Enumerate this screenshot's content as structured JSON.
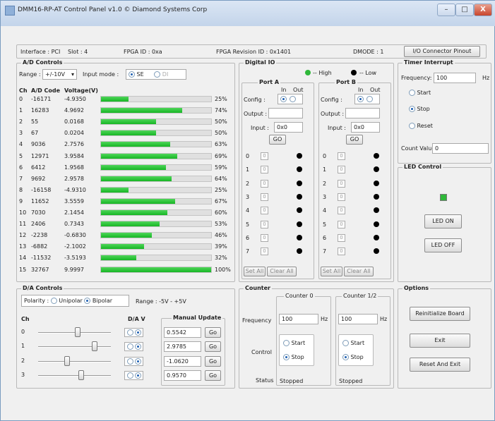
{
  "window": {
    "title": "DMM16-RP-AT Control Panel v1.0 © Diamond Systems Corp",
    "min": "–",
    "max": "□",
    "close": "X"
  },
  "info": {
    "interface": "Interface : PCI",
    "slot": "Slot : 4",
    "fpga_id": "FPGA ID : 0xa",
    "fpga_rev": "FPGA Revision ID : 0x1401",
    "dmode": "DMODE : 1",
    "pinout_btn": "I/O Connector Pinout"
  },
  "ad": {
    "title": "A/D Controls",
    "range_label": "Range :",
    "range_value": "+/-10V",
    "input_mode_label": "Input mode :",
    "mode_se": "SE",
    "mode_di": "DI",
    "headers": [
      "Ch",
      "A/D Code",
      "Voltage(V)"
    ],
    "rows": [
      {
        "ch": "0",
        "code": "-16171",
        "volt": "-4.9350",
        "pct": "25%",
        "val": 25
      },
      {
        "ch": "1",
        "code": "16283",
        "volt": "4.9692",
        "pct": "74%",
        "val": 74
      },
      {
        "ch": "2",
        "code": "55",
        "volt": "0.0168",
        "pct": "50%",
        "val": 50
      },
      {
        "ch": "3",
        "code": "67",
        "volt": "0.0204",
        "pct": "50%",
        "val": 50
      },
      {
        "ch": "4",
        "code": "9036",
        "volt": "2.7576",
        "pct": "63%",
        "val": 63
      },
      {
        "ch": "5",
        "code": "12971",
        "volt": "3.9584",
        "pct": "69%",
        "val": 69
      },
      {
        "ch": "6",
        "code": "6412",
        "volt": "1.9568",
        "pct": "59%",
        "val": 59
      },
      {
        "ch": "7",
        "code": "9692",
        "volt": "2.9578",
        "pct": "64%",
        "val": 64
      },
      {
        "ch": "8",
        "code": "-16158",
        "volt": "-4.9310",
        "pct": "25%",
        "val": 25
      },
      {
        "ch": "9",
        "code": "11652",
        "volt": "3.5559",
        "pct": "67%",
        "val": 67
      },
      {
        "ch": "10",
        "code": "7030",
        "volt": "2.1454",
        "pct": "60%",
        "val": 60
      },
      {
        "ch": "11",
        "code": "2406",
        "volt": "0.7343",
        "pct": "53%",
        "val": 53
      },
      {
        "ch": "12",
        "code": "-2238",
        "volt": "-0.6830",
        "pct": "46%",
        "val": 46
      },
      {
        "ch": "13",
        "code": "-6882",
        "volt": "-2.1002",
        "pct": "39%",
        "val": 39
      },
      {
        "ch": "14",
        "code": "-11532",
        "volt": "-3.5193",
        "pct": "32%",
        "val": 32
      },
      {
        "ch": "15",
        "code": "32767",
        "volt": "9.9997",
        "pct": "100%",
        "val": 100
      }
    ]
  },
  "dio": {
    "title": "Digital IO",
    "high": "-- High",
    "low": "-- Low",
    "portA": {
      "title": "Port A",
      "in": "In",
      "out": "Out",
      "config": "Config :",
      "output": "Output :",
      "input_label": "Input :",
      "input_value": "0x0",
      "go": "GO",
      "set_all": "Set All",
      "clear_all": "Clear All"
    },
    "portB": {
      "title": "Port B",
      "in": "In",
      "out": "Out",
      "config": "Config :",
      "output": "Output :",
      "input_label": "Input :",
      "input_value": "0x0",
      "go": "GO",
      "set_all": "Set All",
      "clear_all": "Clear All"
    },
    "bits": [
      "0",
      "1",
      "2",
      "3",
      "4",
      "5",
      "6",
      "7"
    ],
    "check_mark": "0"
  },
  "timer": {
    "title": "Timer Interrupt",
    "freq_label": "Frequency:",
    "freq_value": "100",
    "hz": "Hz",
    "start": "Start",
    "stop": "Stop",
    "reset": "Reset",
    "count_label": "Count Value",
    "count_value": "0"
  },
  "led": {
    "title": "LED Control",
    "on": "LED ON",
    "off": "LED OFF",
    "color": "#2fb83a"
  },
  "da": {
    "title": "D/A Controls",
    "polarity_label": "Polarity :",
    "unipolar": "Unipolar",
    "bipolar": "Bipolar",
    "range": "Range : -5V - +5V",
    "ch_header": "Ch",
    "dav_header": "D/A V",
    "manual_header": "Manual Update",
    "rows": [
      {
        "ch": "0",
        "value": "0.5542",
        "go": "Go",
        "level": 0.55
      },
      {
        "ch": "1",
        "value": "2.9785",
        "go": "Go",
        "level": 0.8
      },
      {
        "ch": "2",
        "value": "-1.0620",
        "go": "Go",
        "level": 0.39
      },
      {
        "ch": "3",
        "value": "0.9570",
        "go": "Go",
        "level": 0.6
      }
    ]
  },
  "counter": {
    "title": "Counter",
    "c0_title": "Counter 0",
    "c12_title": "Counter 1/2",
    "freq_label": "Frequency",
    "c0_freq": "100",
    "c12_freq": "100",
    "hz": "Hz",
    "control_label": "Control",
    "start": "Start",
    "stop": "Stop",
    "status_label": "Status",
    "c0_status": "Stopped",
    "c12_status": "Stopped"
  },
  "options": {
    "title": "Options",
    "reinit": "Reinitialize Board",
    "exit": "Exit",
    "reset_exit": "Reset And Exit"
  }
}
